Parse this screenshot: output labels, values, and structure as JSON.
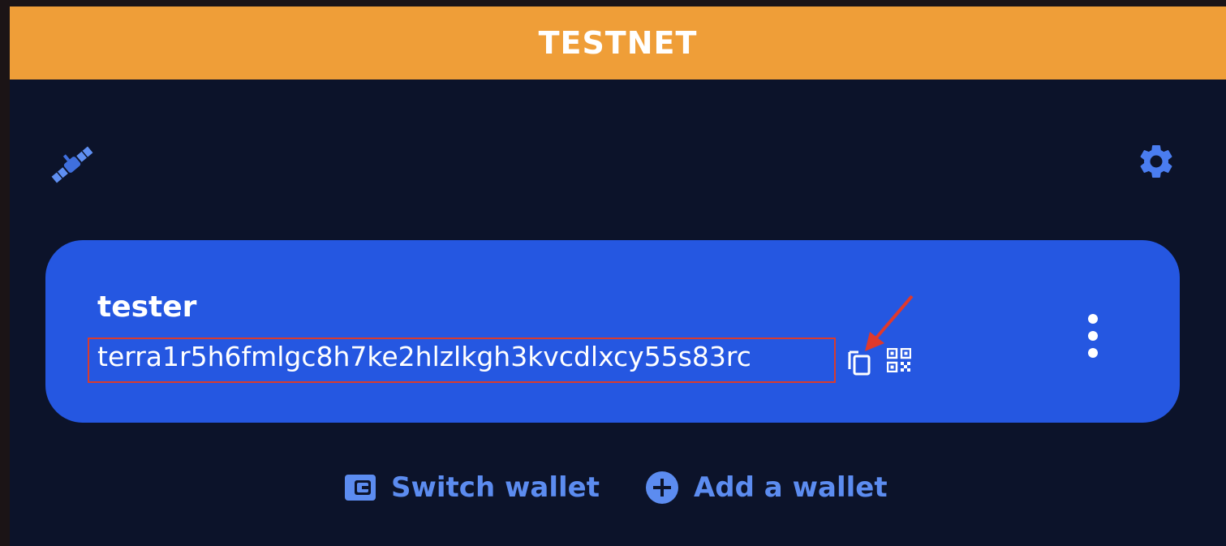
{
  "banner": {
    "label": "TESTNET"
  },
  "header": {
    "satellite_icon": "satellite-icon",
    "settings_icon": "gear-icon"
  },
  "wallet": {
    "name": "tester",
    "address": "terra1r5h6fmlgc8h7ke2hlzlkgh3kvcdlxcy55s83rc",
    "copy_icon": "copy-icon",
    "qr_icon": "qr-code-icon",
    "more_icon": "more-vertical-icon"
  },
  "actions": {
    "switch_wallet": "Switch wallet",
    "add_wallet": "Add a wallet"
  },
  "colors": {
    "banner": "#ef9e38",
    "background": "#0c132a",
    "card": "#2557e1",
    "accent": "#5c8cf0",
    "highlight": "#d93c2e"
  }
}
